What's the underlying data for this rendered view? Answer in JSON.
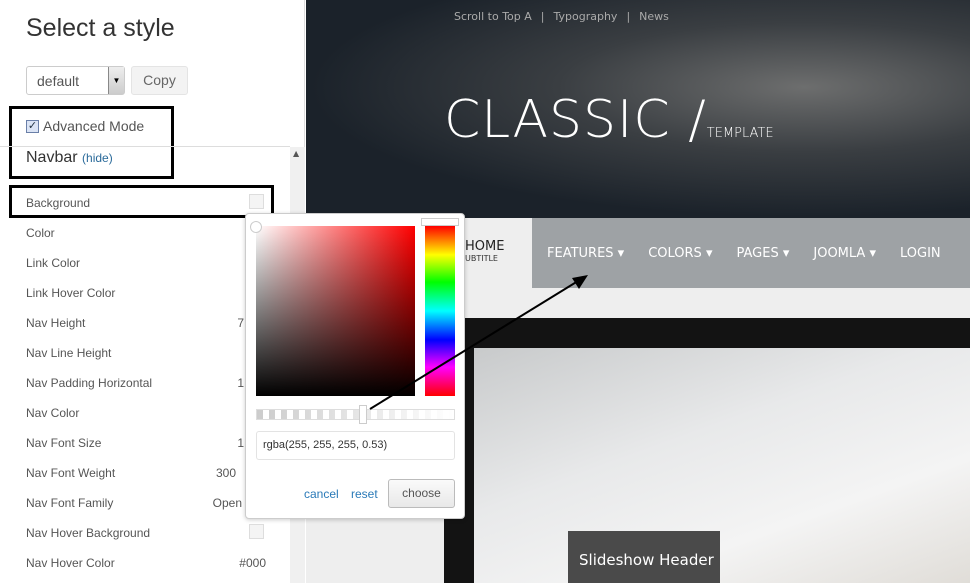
{
  "panel": {
    "title": "Select a style",
    "style_select": "default",
    "copy_label": "Copy",
    "advanced_mode": "Advanced Mode",
    "advanced_checked": true,
    "section": "Navbar",
    "hide_link": "(hide)",
    "rows": [
      {
        "label": "Background",
        "value": ""
      },
      {
        "label": "Color",
        "value": ""
      },
      {
        "label": "Link Color",
        "value": ""
      },
      {
        "label": "Link Hover Color",
        "value": ""
      },
      {
        "label": "Nav Height",
        "value": "7"
      },
      {
        "label": "Nav Line Height",
        "value": ""
      },
      {
        "label": "Nav Padding Horizontal",
        "value": "1"
      },
      {
        "label": "Nav Color",
        "value": ""
      },
      {
        "label": "Nav Font Size",
        "value": "1"
      },
      {
        "label": "Nav Font Weight",
        "value": "300"
      },
      {
        "label": "Nav Font Family",
        "value": "Open"
      },
      {
        "label": "Nav Hover Background",
        "value": ""
      },
      {
        "label": "Nav Hover Color",
        "value": "#000"
      }
    ]
  },
  "picker": {
    "value": "rgba(255, 255, 255, 0.53)",
    "alpha": 0.53,
    "hue": "#ff0000",
    "cancel": "cancel",
    "reset": "reset",
    "choose": "choose"
  },
  "site": {
    "top_links": [
      "Scroll to Top A",
      "|",
      "Typography",
      "|",
      "News"
    ],
    "brand": "CLASSIC /",
    "brand_sub": "TEMPLATE",
    "logo_home": "HOME",
    "logo_sub": "UBTITLE",
    "nav": [
      "FEATURES",
      "COLORS",
      "PAGES",
      "JOOMLA",
      "LOGIN"
    ],
    "caret": "▾",
    "slide_caption": "Slideshow Header"
  }
}
